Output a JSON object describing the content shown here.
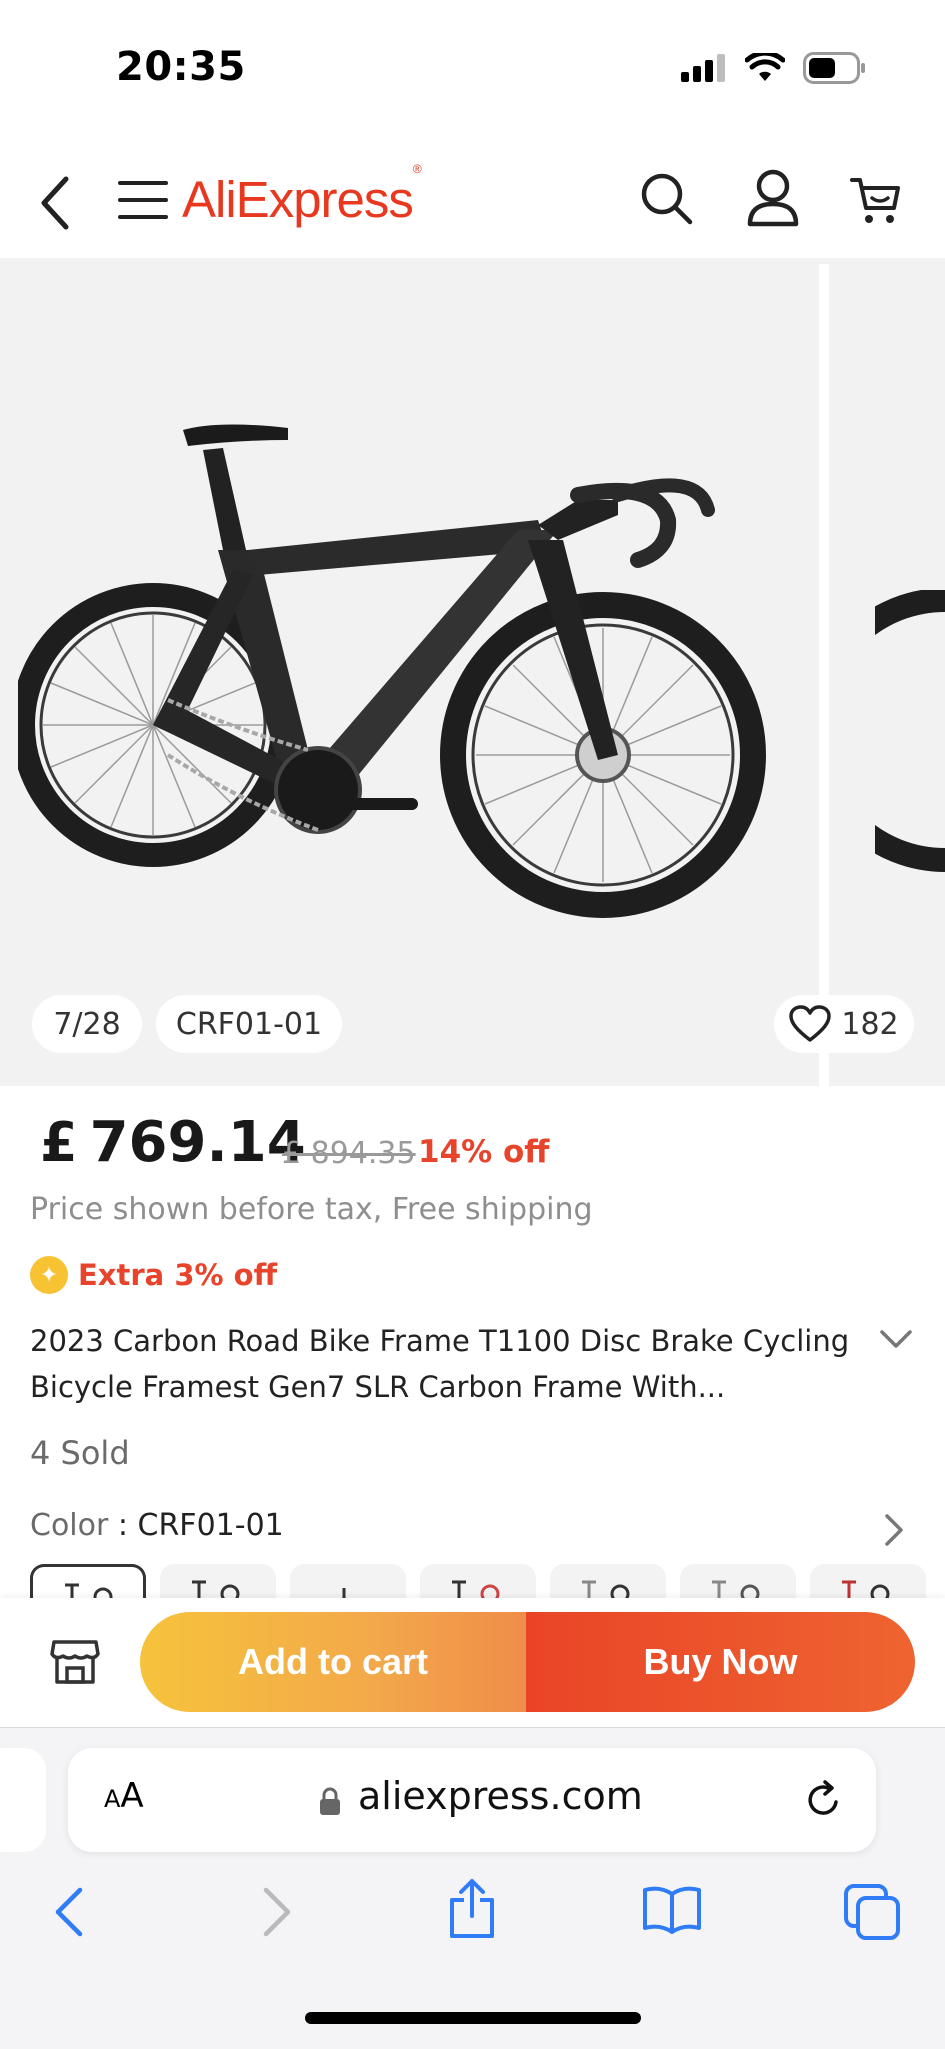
{
  "status_bar": {
    "time": "20:35"
  },
  "header": {
    "logo": "AliExpress",
    "logo_mark": "®",
    "icons": [
      "back-chevron-icon",
      "hamburger-menu-icon",
      "search-icon",
      "account-icon",
      "cart-icon"
    ]
  },
  "gallery": {
    "counter": "7/28",
    "sku_label": "CRF01-01",
    "wishlist_count": "182",
    "progress_fraction": 0.25
  },
  "price": {
    "currency": "£",
    "current": "769.14",
    "original": "£ 894.35",
    "discount": "14% off",
    "tax_note": "Price shown before tax, Free shipping",
    "extra_offer": "Extra 3% off"
  },
  "product": {
    "title": "2023 Carbon Road Bike Frame T1100 Disc Brake Cycling Bicycle Framest Gen7 SLR Carbon Frame With...",
    "sold": "4 Sold",
    "color_label": "Color",
    "color_sep": " : ",
    "color_value": "CRF01-01"
  },
  "actions": {
    "add_to_cart": "Add to cart",
    "buy_now": "Buy Now"
  },
  "browser": {
    "text_size_big": "A",
    "text_size_small": "A",
    "url": "aliexpress.com"
  },
  "colors": {
    "brand": "#e8381f",
    "discount": "#e8432b",
    "cart_gradient_start": "#f6c33c",
    "buy_gradient_start": "#ea4427",
    "safari_blue": "#2f7cf6"
  }
}
